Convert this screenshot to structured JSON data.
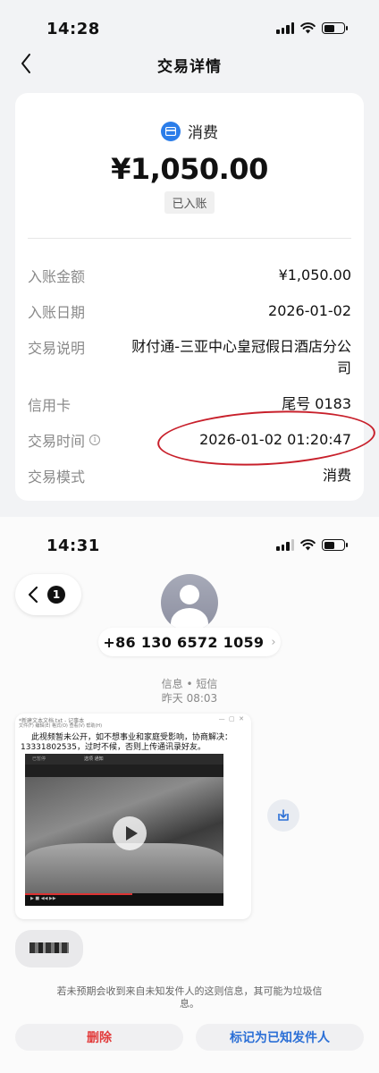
{
  "screen1": {
    "status_time": "14:28",
    "nav_title": "交易详情",
    "category": "消费",
    "amount": "¥1,050.00",
    "status_badge": "已入账",
    "rows": [
      {
        "label": "入账金额",
        "value": "¥1,050.00"
      },
      {
        "label": "入账日期",
        "value": "2026-01-02"
      },
      {
        "label": "交易说明",
        "value": "财付通-三亚中心皇冠假日酒店分公司"
      },
      {
        "label": "信用卡",
        "value": "尾号 0183"
      },
      {
        "label": "交易时间",
        "value": "2026-01-02 01:20:47"
      },
      {
        "label": "交易模式",
        "value": "消费"
      }
    ],
    "accent_color": "#2b7de9",
    "highlight_color": "#c8202b"
  },
  "screen2": {
    "status_time": "14:31",
    "back_count": "1",
    "phone_number": "+86 130 6572 1059",
    "message_type": "信息 • 短信",
    "message_time": "昨天 08:03",
    "attachment": {
      "notepad_title": "*新建文本文档.txt - 记事本",
      "notepad_menu": "文件(F)  编辑(E)  格式(O)  查看(V)  帮助(H)",
      "text_line1": "此视频暂未公开，如不想事业和家庭受影响，协商解决：",
      "text_line2": "13331802535，过时不候，否则上传通讯录好友。",
      "player_tab1": "已暂停",
      "player_tab2": "选项 通知"
    },
    "warning": "若未预期会收到来自未知发件人的这则信息，其可能为垃圾信息。",
    "delete_label": "删除",
    "mark_known_label": "标记为已知发件人",
    "delete_color": "#e23b3b",
    "link_color": "#2b6fd6"
  }
}
